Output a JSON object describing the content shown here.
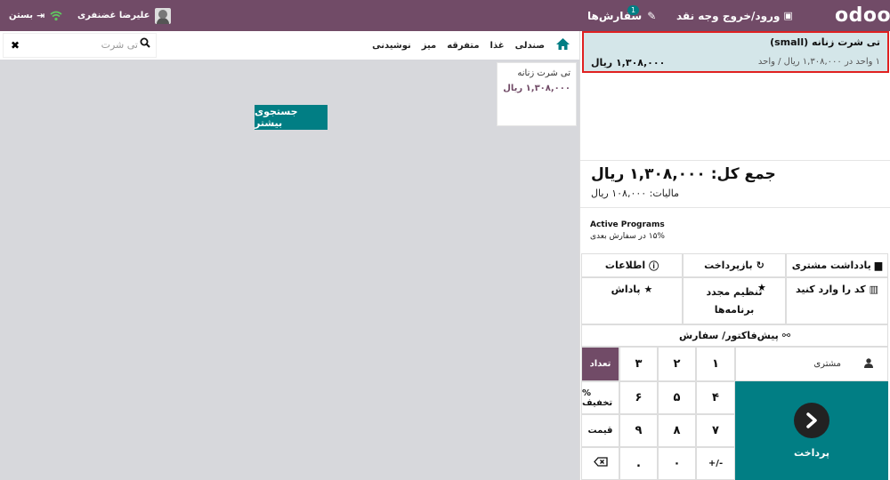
{
  "topbar": {
    "logo": "odoo",
    "cash_label": "ورود/خروج وجه نقد",
    "orders_label": "سفارش‌ها",
    "orders_badge": "1",
    "cashier_name": "علیرضا غضنفری",
    "close_label": "بستن"
  },
  "search": {
    "placeholder": "تی شرت"
  },
  "categories": [
    "صندلی",
    "غذا",
    "متفرقه",
    "میز",
    "نوشیدنی"
  ],
  "product": {
    "name": "تی شرت زنانه",
    "price": "۱,۳۰۸,۰۰۰ ریال"
  },
  "more_search_label": "جستجوی بیشتر",
  "order_line": {
    "name": "تی شرت زنانه (small)",
    "detail": "۱ واحد در ۱,۳۰۸,۰۰۰ ریال / واحد",
    "price": "۱,۳۰۸,۰۰۰ ریال"
  },
  "totals": {
    "total": "جمع کل: ۱,۳۰۸,۰۰۰ ریال",
    "tax": "مالیات: ۱۰۸,۰۰۰ ریال"
  },
  "programs": {
    "title": "Active Programs",
    "text": "۱۵% در سفارش بعدی"
  },
  "actions": {
    "customer_note": "یادداشت مشتری",
    "refund": "بازپرداخت",
    "info": "اطلاعات",
    "enter_code": "کد را وارد کنید",
    "reset_programs": "تنظیم مجدد برنامه‌ها",
    "reward": "پاداش",
    "proforma": "پیش‌فاکتور/ سفارش"
  },
  "numpad": {
    "k1": "۱",
    "k2": "۲",
    "k3": "۳",
    "k4": "۴",
    "k5": "۵",
    "k6": "۶",
    "k7": "۷",
    "k8": "۸",
    "k9": "۹",
    "k0": "۰",
    "dot": ".",
    "plusminus": "+/-",
    "qty": "تعداد",
    "discount": "% تخفیف",
    "price": "قیمت"
  },
  "customer_label": "مشتری",
  "pay_label": "پرداخت"
}
